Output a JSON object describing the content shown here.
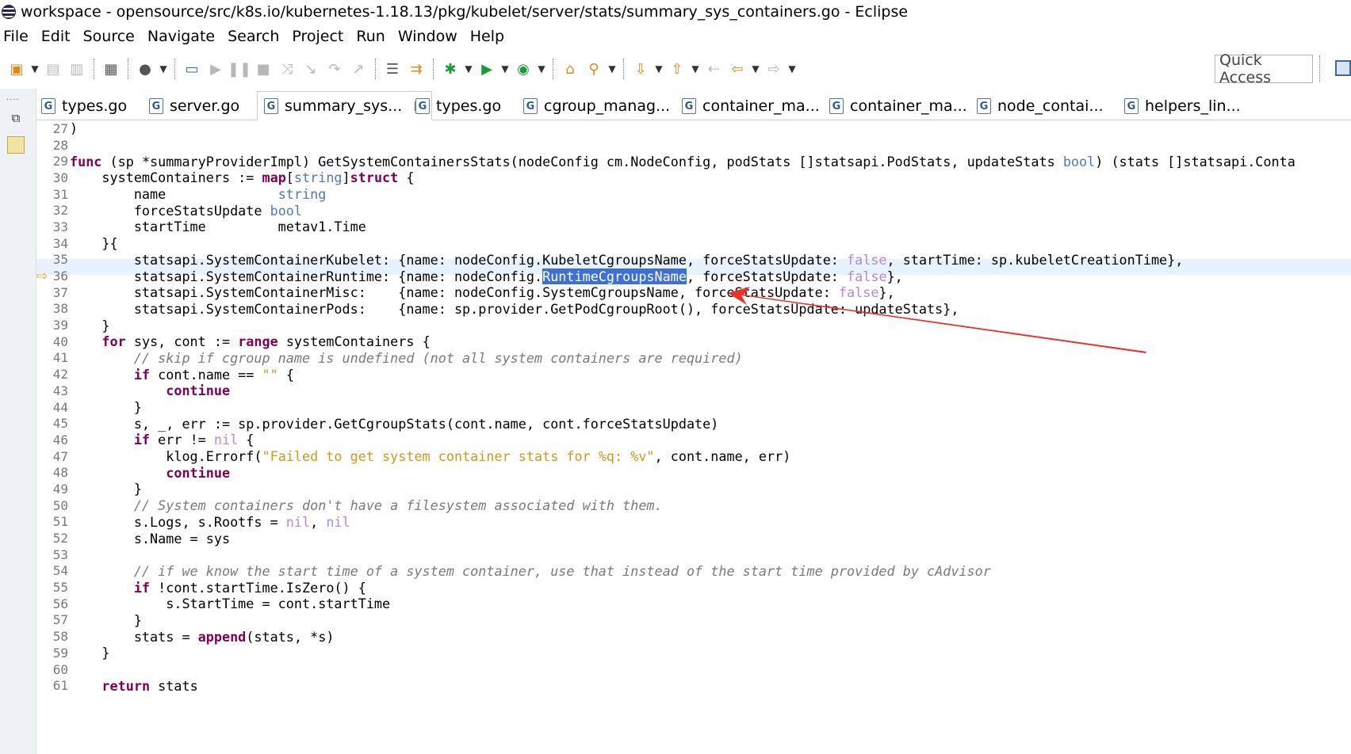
{
  "window": {
    "title": "workspace - opensource/src/k8s.io/kubernetes-1.18.13/pkg/kubelet/server/stats/summary_sys_containers.go - Eclipse"
  },
  "menu": [
    "File",
    "Edit",
    "Source",
    "Navigate",
    "Search",
    "Project",
    "Run",
    "Window",
    "Help"
  ],
  "toolbar": {
    "quick_access": "Quick Access",
    "icons": [
      "new-wizard-icon",
      "save-icon",
      "save-all-icon",
      "build-icon",
      "debug-target-icon",
      "console-icon",
      "resume-icon",
      "suspend-icon",
      "terminate-icon",
      "disconnect-icon",
      "step-into-icon",
      "step-over-icon",
      "step-return-icon",
      "drop-to-frame-icon",
      "use-step-filters-icon",
      "debug-icon",
      "run-icon",
      "coverage-icon",
      "open-task-icon",
      "search-icon",
      "next-annotation-icon",
      "previous-annotation-icon",
      "last-edit-location-icon",
      "back-icon",
      "forward-icon"
    ]
  },
  "tabs": [
    {
      "label": "types.go",
      "active": false
    },
    {
      "label": "server.go",
      "active": false
    },
    {
      "label": "summary_sys...",
      "active": true,
      "close": "☒"
    },
    {
      "label": "types.go",
      "active": false
    },
    {
      "label": "cgroup_manag...",
      "active": false
    },
    {
      "label": "container_ma...",
      "active": false
    },
    {
      "label": "container_ma...",
      "active": false
    },
    {
      "label": "node_contai...",
      "active": false
    },
    {
      "label": "helpers_lin...",
      "active": false
    }
  ],
  "editor": {
    "current_line": "36",
    "selection": "RuntimeCgroupsName",
    "lines": [
      {
        "n": "27",
        "t": ")"
      },
      {
        "n": "28",
        "t": ""
      },
      {
        "n": "29",
        "t": "func (sp *summaryProviderImpl) GetSystemContainersStats(nodeConfig cm.NodeConfig, podStats []statsapi.PodStats, updateStats bool) (stats []statsapi.Conta"
      },
      {
        "n": "30",
        "t": "    systemContainers := map[string]struct {"
      },
      {
        "n": "31",
        "t": "        name              string"
      },
      {
        "n": "32",
        "t": "        forceStatsUpdate bool"
      },
      {
        "n": "33",
        "t": "        startTime         metav1.Time"
      },
      {
        "n": "34",
        "t": "    }{"
      },
      {
        "n": "35",
        "t": "        statsapi.SystemContainerKubelet: {name: nodeConfig.KubeletCgroupsName, forceStatsUpdate: false, startTime: sp.kubeletCreationTime},"
      },
      {
        "n": "36",
        "t": "        statsapi.SystemContainerRuntime: {name: nodeConfig.RuntimeCgroupsName, forceStatsUpdate: false},"
      },
      {
        "n": "37",
        "t": "        statsapi.SystemContainerMisc:    {name: nodeConfig.SystemCgroupsName, forceStatsUpdate: false},"
      },
      {
        "n": "38",
        "t": "        statsapi.SystemContainerPods:    {name: sp.provider.GetPodCgroupRoot(), forceStatsUpdate: updateStats},"
      },
      {
        "n": "39",
        "t": "    }"
      },
      {
        "n": "40",
        "t": "    for sys, cont := range systemContainers {"
      },
      {
        "n": "41",
        "t": "        // skip if cgroup name is undefined (not all system containers are required)"
      },
      {
        "n": "42",
        "t": "        if cont.name == \"\" {"
      },
      {
        "n": "43",
        "t": "            continue"
      },
      {
        "n": "44",
        "t": "        }"
      },
      {
        "n": "45",
        "t": "        s, _, err := sp.provider.GetCgroupStats(cont.name, cont.forceStatsUpdate)"
      },
      {
        "n": "46",
        "t": "        if err != nil {"
      },
      {
        "n": "47",
        "t": "            klog.Errorf(\"Failed to get system container stats for %q: %v\", cont.name, err)"
      },
      {
        "n": "48",
        "t": "            continue"
      },
      {
        "n": "49",
        "t": "        }"
      },
      {
        "n": "50",
        "t": "        // System containers don't have a filesystem associated with them."
      },
      {
        "n": "51",
        "t": "        s.Logs, s.Rootfs = nil, nil"
      },
      {
        "n": "52",
        "t": "        s.Name = sys"
      },
      {
        "n": "53",
        "t": ""
      },
      {
        "n": "54",
        "t": "        // if we know the start time of a system container, use that instead of the start time provided by cAdvisor"
      },
      {
        "n": "55",
        "t": "        if !cont.startTime.IsZero() {"
      },
      {
        "n": "56",
        "t": "            s.StartTime = cont.startTime"
      },
      {
        "n": "57",
        "t": "        }"
      },
      {
        "n": "58",
        "t": "        stats = append(stats, *s)"
      },
      {
        "n": "59",
        "t": "    }"
      },
      {
        "n": "60",
        "t": ""
      },
      {
        "n": "61",
        "t": "    return stats"
      }
    ]
  },
  "colors": {
    "keyword": "#7f0055",
    "type": "#4f78b8",
    "comment": "#7a7a7a",
    "string": "#c89b1d",
    "boolean_nil": "#b08ad8",
    "selection": "#3d6fd5",
    "current_line_bg": "#e8f2fe",
    "annotation_arrow": "#e8332a"
  }
}
